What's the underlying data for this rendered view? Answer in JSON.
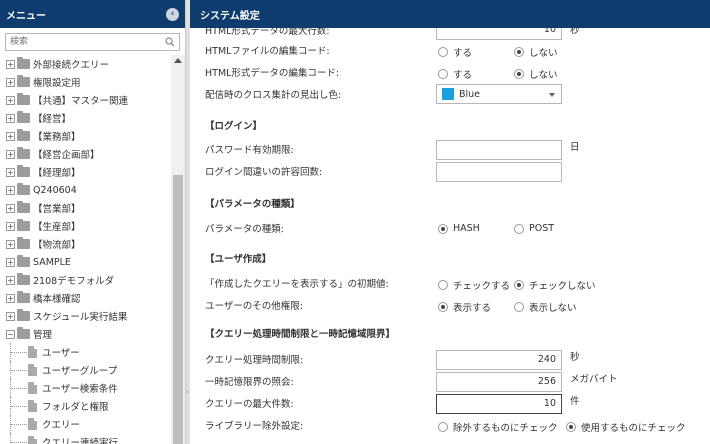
{
  "sidebar": {
    "title": "メニュー",
    "search_placeholder": "検索",
    "items": [
      {
        "label": "外部接続クエリー",
        "type": "folder"
      },
      {
        "label": "権限設定用",
        "type": "folder"
      },
      {
        "label": "【共通】マスター関連",
        "type": "folder"
      },
      {
        "label": "【経営】",
        "type": "folder"
      },
      {
        "label": "【業務部】",
        "type": "folder"
      },
      {
        "label": "【経営企画部】",
        "type": "folder"
      },
      {
        "label": "【経理部】",
        "type": "folder"
      },
      {
        "label": "Q240604",
        "type": "folder"
      },
      {
        "label": "【営業部】",
        "type": "folder"
      },
      {
        "label": "【生産部】",
        "type": "folder"
      },
      {
        "label": "【物流部】",
        "type": "folder"
      },
      {
        "label": "SAMPLE",
        "type": "folder"
      },
      {
        "label": "2108デモフォルダ",
        "type": "folder"
      },
      {
        "label": "橋本様確認",
        "type": "folder"
      },
      {
        "label": "スケジュール実行結果",
        "type": "folder"
      },
      {
        "label": "管理",
        "type": "folder-open"
      },
      {
        "label": "ユーザー",
        "type": "doc"
      },
      {
        "label": "ユーザーグループ",
        "type": "doc"
      },
      {
        "label": "ユーザー検索条件",
        "type": "doc"
      },
      {
        "label": "フォルダと権限",
        "type": "doc"
      },
      {
        "label": "クエリー",
        "type": "doc"
      },
      {
        "label": "クエリー連続実行",
        "type": "doc"
      }
    ]
  },
  "main": {
    "title": "システム設定",
    "cut_row_label": "HTML形式データの最大行数:",
    "cut_row_value": "10",
    "cut_row_unit": "秒",
    "rows": {
      "html_file_code": {
        "label": "HTMLファイルの編集コード:",
        "options": [
          "する",
          "しない"
        ],
        "selected": 1
      },
      "html_data_code": {
        "label": "HTML形式データの編集コード:",
        "options": [
          "する",
          "しない"
        ],
        "selected": 1
      },
      "cross_color": {
        "label": "配信時のクロス集計の見出し色:",
        "value": "Blue",
        "color": "#1aa0e0"
      }
    },
    "login": {
      "section": "【ログイン】",
      "password_label": "パスワード有効期限:",
      "password_value": "",
      "password_unit": "日",
      "retry_label": "ログイン間違いの許容回数:",
      "retry_value": ""
    },
    "params": {
      "section": "【パラメータの種類】",
      "label": "パラメータの種類:",
      "options": [
        "HASH",
        "POST"
      ],
      "selected": 0
    },
    "user_create": {
      "section": "【ユーザ作成】",
      "initial_label": "「作成したクエリーを表示する」の初期値:",
      "initial_options": [
        "チェックする",
        "チェックしない"
      ],
      "initial_selected": 1,
      "other_label": "ユーザーのその他権限:",
      "other_options": [
        "表示する",
        "表示しない"
      ],
      "other_selected": 0
    },
    "query_limits": {
      "section": "【クエリー処理時間制限と一時記憶域限界】",
      "time_label": "クエリー処理時間制限:",
      "time_value": "240",
      "time_unit": "秒",
      "temp_label": "一時記憶限界の照会:",
      "temp_value": "256",
      "temp_unit": "メガバイト",
      "max_label": "クエリーの最大件数:",
      "max_value": "10",
      "max_unit": "件",
      "lib_label": "ライブラリー除外設定:",
      "lib_options": [
        "除外するものにチェック",
        "使用するものにチェック"
      ],
      "lib_selected": 1
    }
  }
}
